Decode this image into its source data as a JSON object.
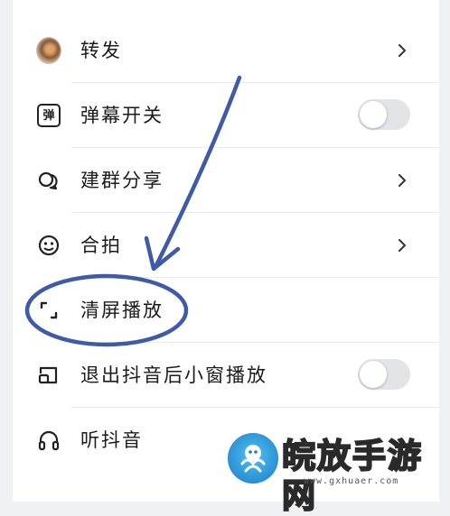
{
  "menu": {
    "items": [
      {
        "label": "转发",
        "icon": "forward-avatar",
        "control": "chevron"
      },
      {
        "label": "弹幕开关",
        "icon": "danmu-icon",
        "control": "toggle",
        "toggle_on": false
      },
      {
        "label": "建群分享",
        "icon": "group-share-icon",
        "control": "chevron"
      },
      {
        "label": "合拍",
        "icon": "duet-icon",
        "control": "chevron"
      },
      {
        "label": "清屏播放",
        "icon": "clear-screen-icon",
        "control": "none"
      },
      {
        "label": "退出抖音后小窗播放",
        "icon": "picture-in-picture-icon",
        "control": "toggle",
        "toggle_on": false
      },
      {
        "label": "听抖音",
        "icon": "headphones-icon",
        "control": "none"
      }
    ],
    "danmu_glyph": "弹"
  },
  "colors": {
    "annotation": "#3e5aa8",
    "toggle_off": "#e3e4e8",
    "text": "#1b1b1b"
  },
  "watermark": {
    "text": "皖放手游网",
    "url": "www.gxhuaer.com"
  }
}
